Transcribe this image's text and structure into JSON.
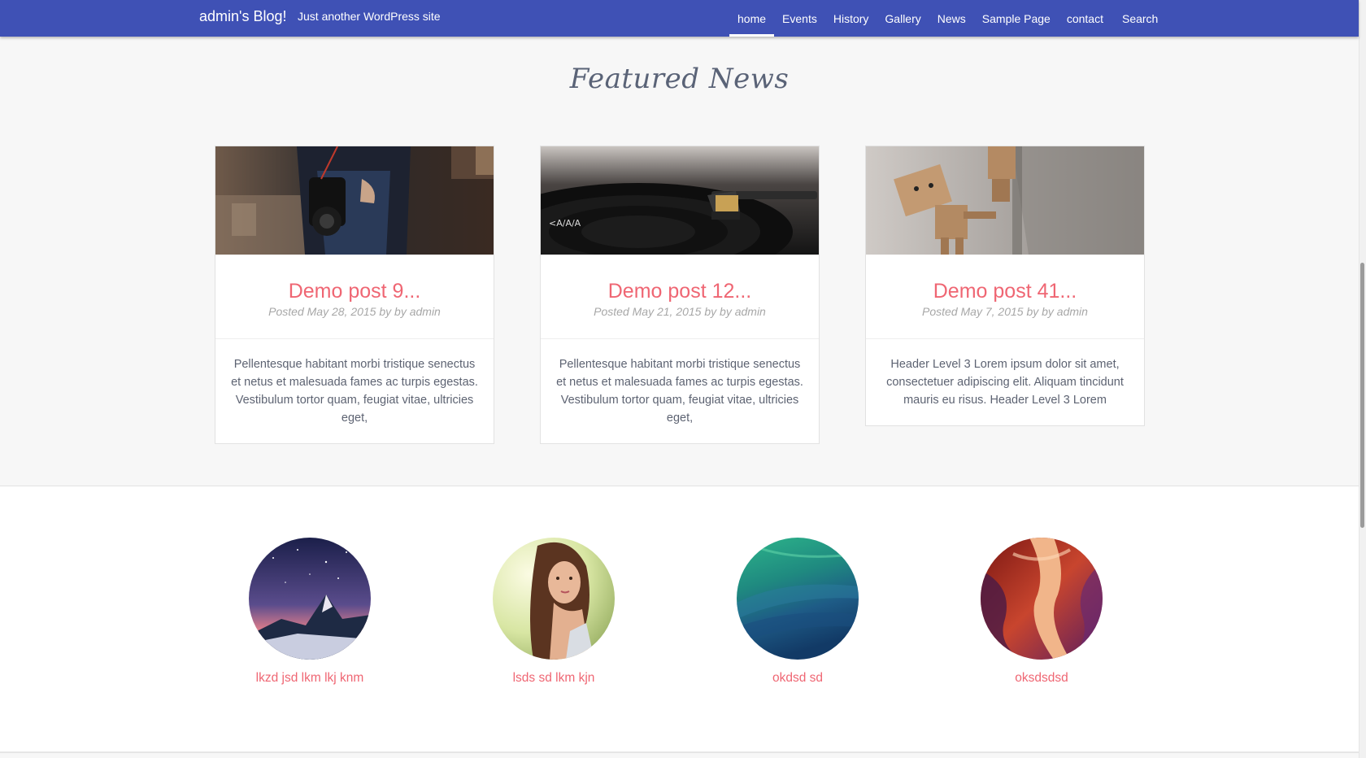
{
  "header": {
    "site_title": "admin's Blog!",
    "tagline": "Just another WordPress site",
    "nav": [
      {
        "label": "home",
        "active": true
      },
      {
        "label": "Events",
        "active": false
      },
      {
        "label": "History",
        "active": false
      },
      {
        "label": "Gallery",
        "active": false
      },
      {
        "label": "News",
        "active": false
      },
      {
        "label": "Sample Page",
        "active": false
      },
      {
        "label": "contact",
        "active": false
      }
    ],
    "search_label": "Search"
  },
  "featured": {
    "title": "Featured News",
    "posts": [
      {
        "title": "Demo post 9...",
        "meta": "Posted May 28, 2015 by by admin",
        "excerpt": "Pellentesque habitant morbi tristique senectus et netus et malesuada fames ac turpis egestas. Vestibulum tortor quam, feugiat vitae, ultricies eget,",
        "image": "photographer-camera"
      },
      {
        "title": "Demo post 12...",
        "meta": "Posted May 21, 2015 by by admin",
        "excerpt": "Pellentesque habitant morbi tristique senectus et netus et malesuada fames ac turpis egestas. Vestibulum tortor quam, feugiat vitae, ultricies eget,",
        "image": "turntable-record"
      },
      {
        "title": "Demo post 41...",
        "meta": "Posted May 7, 2015 by by admin",
        "excerpt": "Header Level 3 Lorem ipsum dolor sit amet, consectetuer adipiscing elit. Aliquam tincidunt mauris eu risus. Header Level 3 Lorem",
        "image": "cardboard-robot"
      }
    ]
  },
  "features": [
    {
      "label": "lkzd jsd lkm lkj knm",
      "image": "mountain-starry-night"
    },
    {
      "label": "lsds sd lkm kjn",
      "image": "woman-portrait"
    },
    {
      "label": "okdsd sd",
      "image": "green-wave"
    },
    {
      "label": "oksdsdsd",
      "image": "red-canyon"
    }
  ],
  "colors": {
    "header_bg": "#3f51b5",
    "accent": "#ef6673",
    "body_text": "#5d6372",
    "meta_text": "#a7a7a7",
    "page_bg": "#f7f7f7"
  }
}
